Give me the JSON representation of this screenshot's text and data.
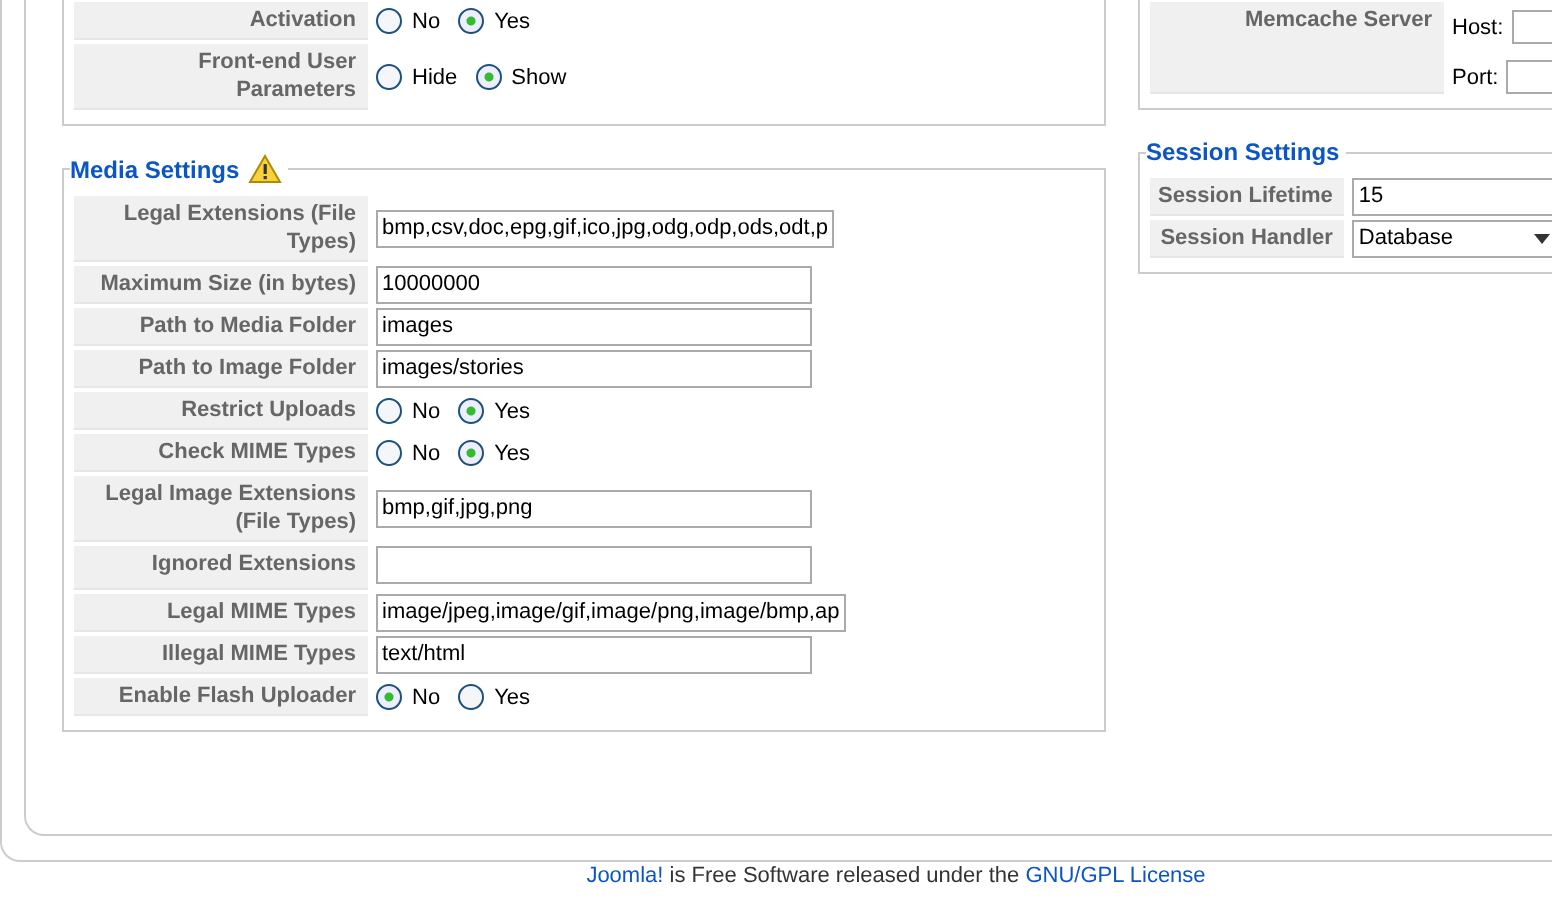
{
  "user_settings": {
    "rows": [
      {
        "label": "Activation",
        "kind": "radio",
        "options": [
          {
            "label": "No",
            "selected": false
          },
          {
            "label": "Yes",
            "selected": true
          }
        ]
      },
      {
        "label": "Front-end User Parameters",
        "kind": "radio",
        "options": [
          {
            "label": "Hide",
            "selected": false
          },
          {
            "label": "Show",
            "selected": true
          }
        ]
      }
    ]
  },
  "media_settings": {
    "title": "Media Settings",
    "rows": [
      {
        "label": "Legal Extensions (File Types)",
        "kind": "text",
        "value": "bmp,csv,doc,epg,gif,ico,jpg,odg,odp,ods,odt,p"
      },
      {
        "label": "Maximum Size (in bytes)",
        "kind": "text",
        "value": "10000000"
      },
      {
        "label": "Path to Media Folder",
        "kind": "text",
        "value": "images"
      },
      {
        "label": "Path to Image Folder",
        "kind": "text",
        "value": "images/stories"
      },
      {
        "label": "Restrict Uploads",
        "kind": "radio",
        "options": [
          {
            "label": "No",
            "selected": false
          },
          {
            "label": "Yes",
            "selected": true
          }
        ]
      },
      {
        "label": "Check MIME Types",
        "kind": "radio",
        "options": [
          {
            "label": "No",
            "selected": false
          },
          {
            "label": "Yes",
            "selected": true
          }
        ]
      },
      {
        "label": "Legal Image Extensions (File Types)",
        "kind": "text",
        "value": "bmp,gif,jpg,png"
      },
      {
        "label": "Ignored Extensions",
        "kind": "text"
      },
      {
        "label": "Legal MIME Types",
        "kind": "text",
        "value": "image/jpeg,image/gif,image/png,image/bmp,ap"
      },
      {
        "label": "Illegal MIME Types",
        "kind": "text",
        "value": "text/html"
      },
      {
        "label": "Enable Flash Uploader",
        "kind": "radio",
        "options": [
          {
            "label": "No",
            "selected": true
          },
          {
            "label": "Yes",
            "selected": false
          }
        ]
      }
    ]
  },
  "cache_settings": {
    "rows": [
      {
        "label": "Memcache Server",
        "kind": "hostport",
        "fields": [
          {
            "label": "Host:"
          },
          {
            "label": "Port:"
          }
        ]
      }
    ]
  },
  "session_settings": {
    "title": "Session Settings",
    "rows": [
      {
        "label": "Session Lifetime",
        "kind": "text",
        "value": "15"
      },
      {
        "label": "Session Handler",
        "kind": "select",
        "value": "Database"
      }
    ]
  },
  "footer": {
    "link": "Joomla!",
    "text": "is Free Software released under the",
    "license_link": "GNU/GPL License"
  }
}
